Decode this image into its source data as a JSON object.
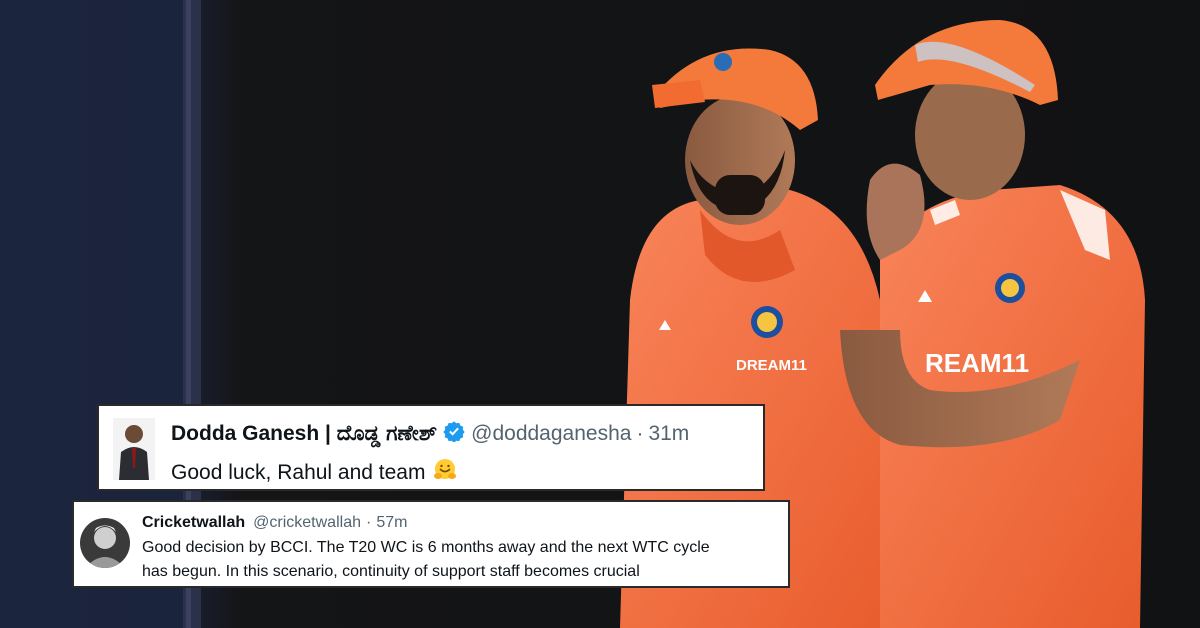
{
  "tweets": [
    {
      "name": "Dodda Ganesh | ದೊಡ್ಡ ಗಣೇಶ್",
      "verified": true,
      "handle": "@doddaganesha",
      "separator": "·",
      "time": "31m",
      "text": "Good luck, Rahul and team",
      "emoji": "smiling-face-with-open-hands-emoji"
    },
    {
      "name": "Cricketwallah",
      "handle": "@cricketwallah",
      "separator": "·",
      "time": "57m",
      "text_line1": "Good decision by BCCI. The T20 WC is 6 months away and the next WTC cycle",
      "text_line2": "has begun. In this scenario, continuity of support staff becomes crucial"
    }
  ],
  "photo": {
    "kit_sponsor_text": "DREAM11",
    "kit_sponsor_text_partial": "REAM11",
    "kit_color": "#f26b3a",
    "cap_color": "#f47a3c"
  }
}
